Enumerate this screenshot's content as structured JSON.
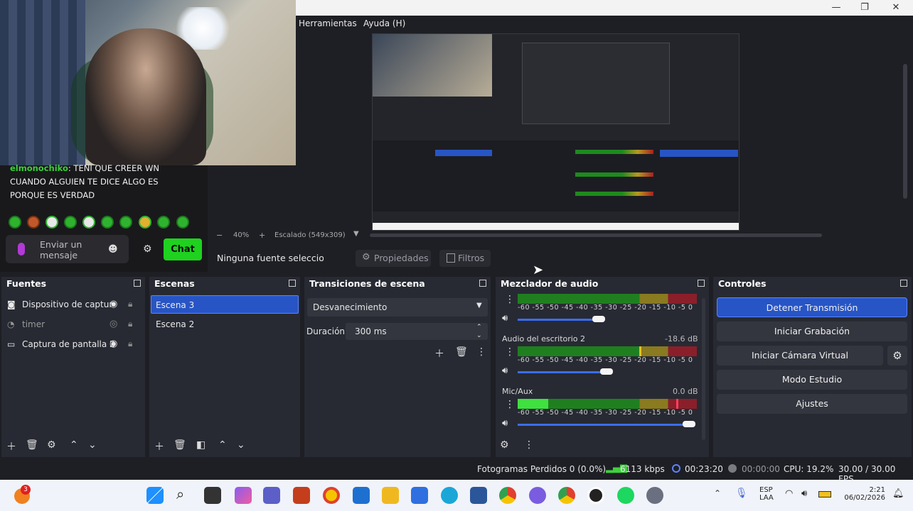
{
  "menu": {
    "tools": "Herramientas",
    "help": "Ayuda (H)"
  },
  "window_controls": {
    "minimize": "—",
    "maximize": "❐",
    "close": "✕"
  },
  "chat": {
    "username": "elmonochiko",
    "message_line1": ": TENI QUE CREER WN",
    "message_line2": "CUANDO ALGUIEN TE DICE ALGO ES",
    "message_line3": "PORQUE ES VERDAD",
    "input_line1": "Enviar un",
    "input_line2": "mensaje",
    "chat_button": "Chat"
  },
  "zoom": {
    "minus": "−",
    "level": "40%",
    "plus": "+",
    "scale": "Escalado (549x309)"
  },
  "source_toolbar": {
    "no_source": "Ninguna fuente seleccionad",
    "properties": "Propiedades",
    "filters": "Filtros"
  },
  "sources": {
    "title": "Fuentes",
    "items": [
      {
        "label": "Dispositivo de captur"
      },
      {
        "label": "timer"
      },
      {
        "label": "Captura de pantalla 2"
      }
    ]
  },
  "scenes": {
    "title": "Escenas",
    "items": [
      {
        "label": "Escena 3"
      },
      {
        "label": "Escena 2"
      }
    ]
  },
  "transitions": {
    "title": "Transiciones de escena",
    "selected": "Desvanecimiento",
    "duration_label": "Duración",
    "duration_value": "300 ms"
  },
  "mixer": {
    "title": "Mezclador de audio",
    "ticks": "-60 -55 -50 -45 -40 -35 -30 -25 -20 -15 -10 -5 0",
    "channels": [
      {
        "name": "",
        "db": ""
      },
      {
        "name": "Audio del escritorio 2",
        "db": "-18.6 dB"
      },
      {
        "name": "Mic/Aux",
        "db": "0.0 dB"
      }
    ]
  },
  "controls": {
    "title": "Controles",
    "stop_stream": "Detener Transmisión",
    "start_recording": "Iniciar Grabación",
    "start_virtual_cam": "Iniciar Cámara Virtual",
    "studio_mode": "Modo Estudio",
    "settings": "Ajustes"
  },
  "status": {
    "dropped": "Fotogramas Perdidos 0 (0.0%)",
    "bitrate": "6113 kbps",
    "stream_time": "00:23:20",
    "rec_time": "00:00:00",
    "cpu": "CPU: 19.2%",
    "fps": "30.00 / 30.00 FPS"
  },
  "taskbar": {
    "badge": "3",
    "lang1": "ESP",
    "lang2": "LAA",
    "time": "2:21",
    "date": "06/02/2026"
  },
  "colors": {
    "accent": "#2855c5",
    "chat_green": "#1fd21f",
    "panel": "#272a33"
  }
}
